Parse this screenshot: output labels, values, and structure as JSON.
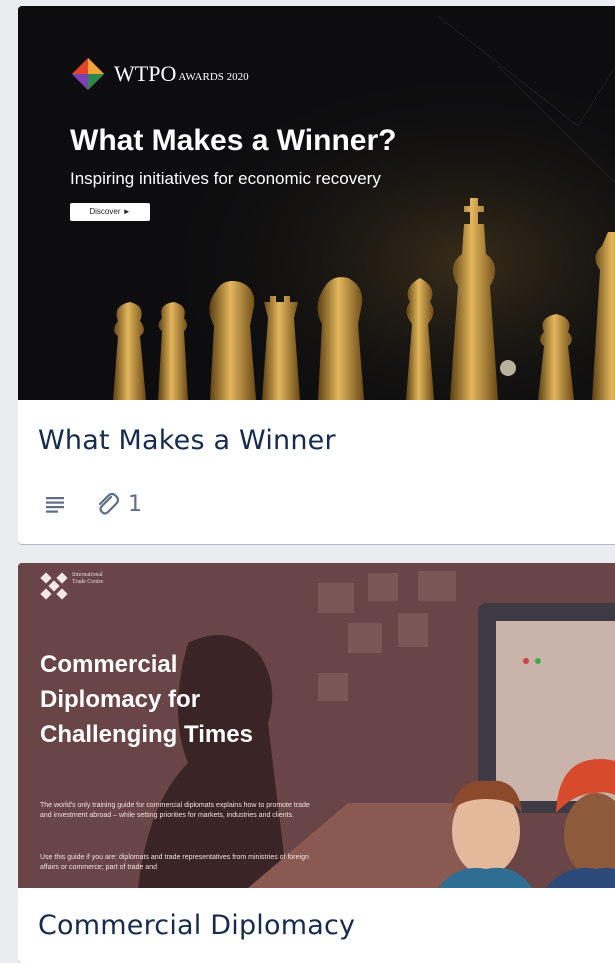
{
  "cards": [
    {
      "title": "What Makes a Winner",
      "attachments_count": "1",
      "cover": {
        "logo_name": "WTPO",
        "logo_suffix": "AWARDS 2020",
        "headline": "What Makes a Winner?",
        "subheadline": "Inspiring initiatives for economic recovery",
        "button_label": "Discover ►"
      }
    },
    {
      "title": "Commercial Diplomacy",
      "cover": {
        "logo_text": "International Trade Centre",
        "headline": "Commercial Diplomacy for Challenging Times",
        "paragraph1": "The world's only training guide for commercial diplomats explains how to promote trade and investment abroad – while setting priorities for markets, industries and clients.",
        "paragraph2": "Use this guide if you are: diplomats and trade representatives from ministries of foreign affairs or commerce; part of trade and"
      }
    }
  ],
  "colors": {
    "board_background": "#ebecf0",
    "card_title": "#172b4d",
    "badge_icon": "#5e6c84"
  },
  "icons": [
    "description-icon",
    "attachment-icon",
    "wtpo-logo-icon",
    "itc-logo-icon"
  ]
}
